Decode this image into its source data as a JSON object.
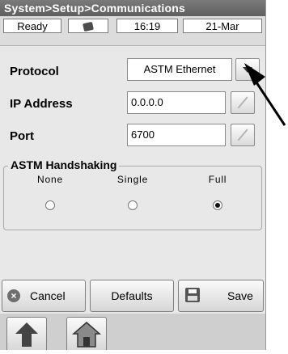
{
  "window": {
    "title": "System>Setup>Communications"
  },
  "status": {
    "state": "Ready",
    "tool_icon": "wrench-icon",
    "time": "16:19",
    "date": "21-Mar"
  },
  "protocol": {
    "label": "Protocol",
    "value": "ASTM Ethernet"
  },
  "ip": {
    "label": "IP Address",
    "value": "0.0.0.0"
  },
  "port": {
    "label": "Port",
    "value": "6700"
  },
  "handshaking": {
    "title": "ASTM Handshaking",
    "options": [
      {
        "label": "None",
        "selected": false
      },
      {
        "label": "Single",
        "selected": false
      },
      {
        "label": "Full",
        "selected": true
      }
    ]
  },
  "buttons": {
    "cancel": "Cancel",
    "defaults": "Defaults",
    "save": "Save"
  },
  "nav": {
    "up_icon": "up-arrow-icon",
    "home_icon": "home-icon"
  }
}
